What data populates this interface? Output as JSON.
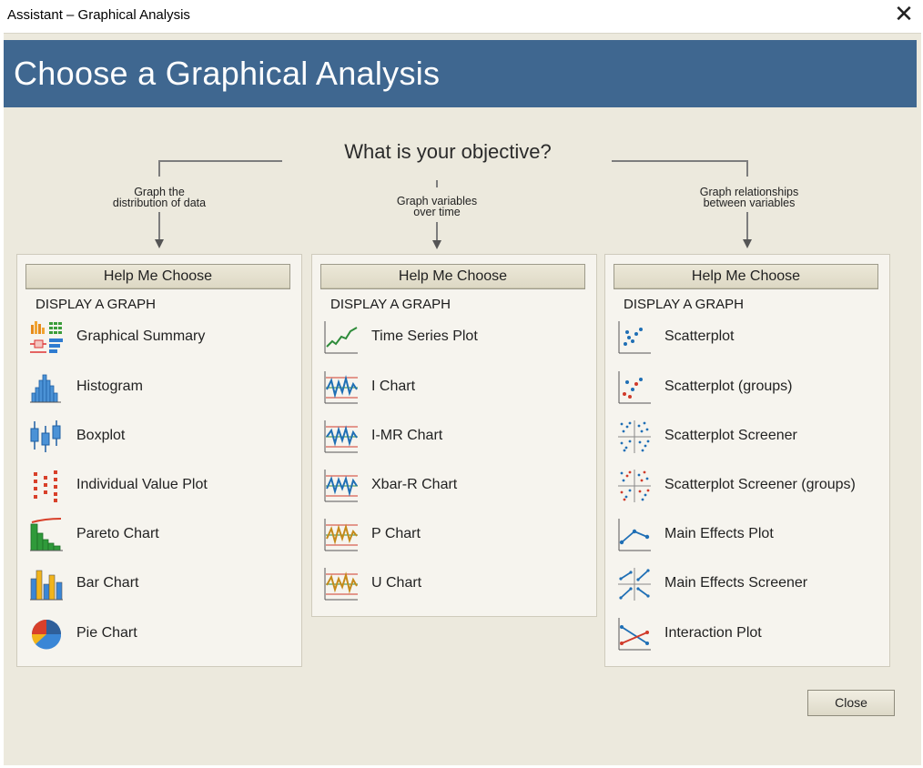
{
  "window": {
    "title": "Assistant – Graphical Analysis",
    "close_glyph": "✕"
  },
  "banner": {
    "title": "Choose a Graphical Analysis"
  },
  "objective": "What is your objective?",
  "branches": [
    {
      "line1": "Graph the",
      "line2": "distribution of data"
    },
    {
      "line1": "Graph variables",
      "line2": "over time"
    },
    {
      "line1": "Graph relationships",
      "line2": "between variables"
    }
  ],
  "panels": [
    {
      "help_label": "Help Me Choose",
      "section": "DISPLAY A GRAPH",
      "items": [
        {
          "label": "Graphical Summary",
          "icon": "graphical-summary-icon"
        },
        {
          "label": "Histogram",
          "icon": "histogram-icon"
        },
        {
          "label": "Boxplot",
          "icon": "boxplot-icon"
        },
        {
          "label": "Individual Value Plot",
          "icon": "individual-value-plot-icon"
        },
        {
          "label": "Pareto Chart",
          "icon": "pareto-chart-icon"
        },
        {
          "label": "Bar Chart",
          "icon": "bar-chart-icon"
        },
        {
          "label": "Pie Chart",
          "icon": "pie-chart-icon"
        }
      ]
    },
    {
      "help_label": "Help Me Choose",
      "section": "DISPLAY A GRAPH",
      "items": [
        {
          "label": "Time Series Plot",
          "icon": "time-series-plot-icon"
        },
        {
          "label": "I Chart",
          "icon": "i-chart-icon"
        },
        {
          "label": "I-MR Chart",
          "icon": "i-mr-chart-icon"
        },
        {
          "label": "Xbar-R Chart",
          "icon": "xbar-r-chart-icon"
        },
        {
          "label": "P Chart",
          "icon": "p-chart-icon"
        },
        {
          "label": "U Chart",
          "icon": "u-chart-icon"
        }
      ]
    },
    {
      "help_label": "Help Me Choose",
      "section": "DISPLAY A GRAPH",
      "items": [
        {
          "label": "Scatterplot",
          "icon": "scatterplot-icon"
        },
        {
          "label": "Scatterplot (groups)",
          "icon": "scatterplot-groups-icon"
        },
        {
          "label": "Scatterplot Screener",
          "icon": "scatterplot-screener-icon"
        },
        {
          "label": "Scatterplot Screener (groups)",
          "icon": "scatterplot-screener-groups-icon"
        },
        {
          "label": "Main Effects Plot",
          "icon": "main-effects-plot-icon"
        },
        {
          "label": "Main Effects Screener",
          "icon": "main-effects-screener-icon"
        },
        {
          "label": "Interaction Plot",
          "icon": "interaction-plot-icon"
        }
      ]
    }
  ],
  "footer": {
    "close_label": "Close"
  },
  "colors": {
    "banner": "#3f6790",
    "background": "#ece9dd",
    "panel": "#f6f4ee",
    "control_line_blue": "#1f6fb5",
    "control_line_gold": "#c58a1a",
    "limit_red": "#d03a2a"
  }
}
